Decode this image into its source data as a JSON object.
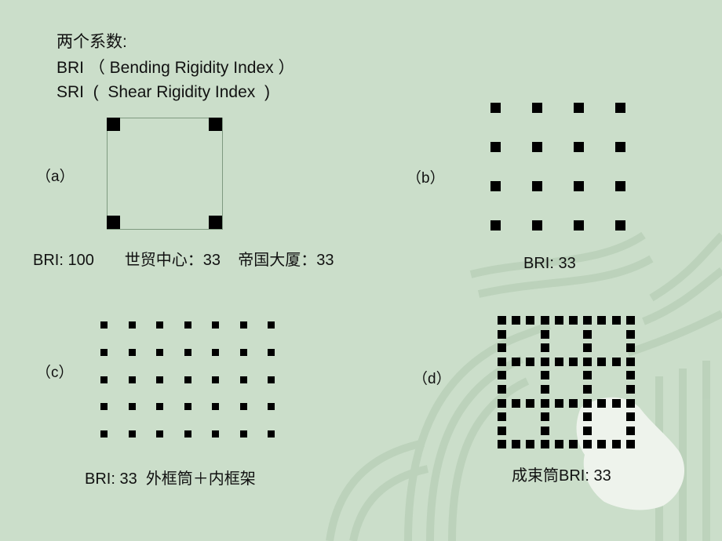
{
  "header": {
    "line1": "两个系数:",
    "line2": "BRI （ Bending Rigidity Index ）",
    "line3": "SRI  (  Shear Rigidity Index  )"
  },
  "panels": {
    "a": {
      "label": "（a）",
      "caption": "BRI: 100       世贸中心：33    帝国大厦：33",
      "layout": "four-corner-columns-in-square-frame"
    },
    "b": {
      "label": "（b）",
      "caption": "BRI: 33",
      "grid": {
        "rows": 4,
        "cols": 4
      }
    },
    "c": {
      "label": "（c）",
      "caption": "BRI: 33  外框筒＋内框架",
      "grid": {
        "rows": 5,
        "cols": 7
      }
    },
    "d": {
      "label": "（d）",
      "caption": "成束筒BRI: 33",
      "grid": {
        "rows": 10,
        "cols": 10,
        "tube_lines": [
          0,
          3,
          6,
          9
        ]
      }
    }
  },
  "colors": {
    "background": "#cbdeca",
    "column": "#000000",
    "frame_line": "#7f9a80",
    "pattern": "#b5cdb4",
    "ornament": "#eef3ec"
  }
}
